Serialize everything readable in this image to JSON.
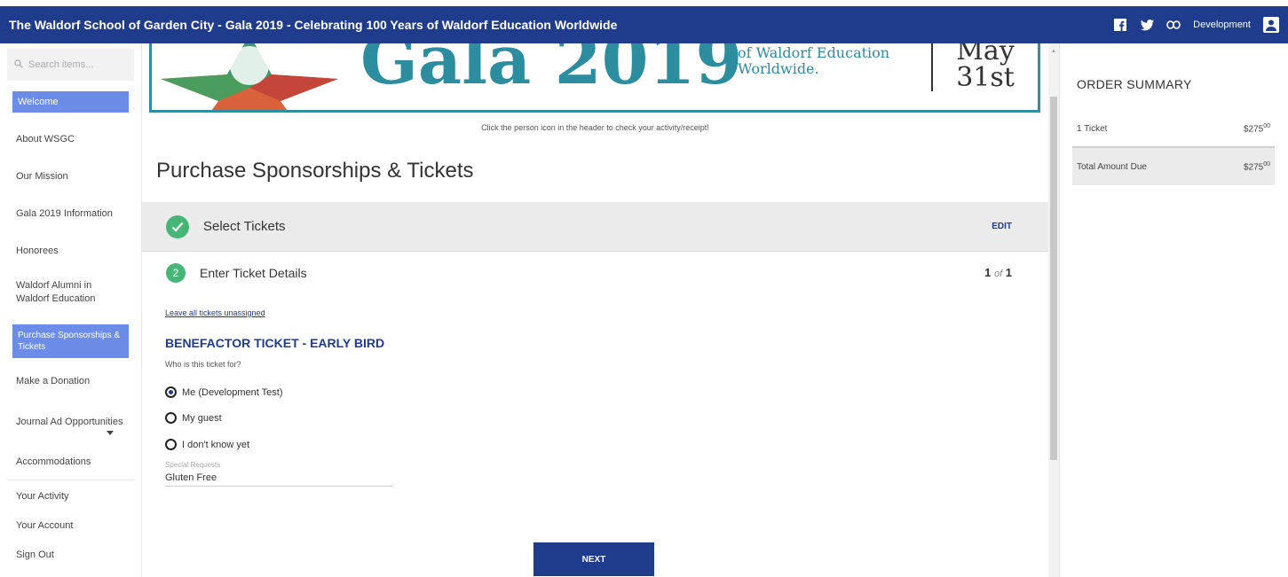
{
  "header": {
    "title": "The Waldorf School of Garden City - Gala 2019 - Celebrating 100 Years of Waldorf Education Worldwide",
    "user": "Development",
    "icons": [
      "facebook-icon",
      "twitter-icon",
      "link-icon",
      "user-icon"
    ]
  },
  "sidebar": {
    "search_placeholder": "Search items...",
    "items": [
      {
        "label": "Welcome",
        "active": true
      },
      {
        "label": "About WSGC"
      },
      {
        "label": "Our Mission"
      },
      {
        "label": "Gala 2019 Information"
      },
      {
        "label": "Honorees"
      },
      {
        "label": "Waldorf Alumni in Waldorf Education"
      },
      {
        "label": "Purchase Sponsorships & Tickets",
        "active": true
      },
      {
        "label": "Make a Donation"
      },
      {
        "label": "Journal Ad Opportunities"
      },
      {
        "label": "Accommodations"
      },
      {
        "label": "Your Activity"
      },
      {
        "label": "Your Account"
      },
      {
        "label": "Sign Out"
      }
    ]
  },
  "banner": {
    "gala": "Gala 2019",
    "subtitle_line1": "of Waldorf Education",
    "subtitle_line2": "Worldwide.",
    "date_line1": "May",
    "date_line2": "31st"
  },
  "main": {
    "notice": "Click the person icon in the header to check your activity/receipt!",
    "page_title": "Purchase Sponsorships & Tickets",
    "step1": {
      "label": "Select Tickets",
      "edit": "EDIT"
    },
    "step2": {
      "number": "2",
      "label": "Enter Ticket Details",
      "current": "1",
      "of": "of",
      "total": "1"
    },
    "unassign_link": "Leave all tickets unassigned",
    "ticket_name": "BENEFACTOR TICKET - EARLY BIRD",
    "who_question": "Who is this ticket for?",
    "options": [
      {
        "label": "Me (Development Test)",
        "checked": true
      },
      {
        "label": "My guest",
        "checked": false
      },
      {
        "label": "I don't know yet",
        "checked": false
      }
    ],
    "special_requests_label": "Special Requests",
    "special_requests_value": "Gluten Free",
    "next_button": "NEXT"
  },
  "summary": {
    "heading": "ORDER SUMMARY",
    "line_item": {
      "label": "1 Ticket",
      "amount": "$275",
      "cents": "00"
    },
    "total": {
      "label": "Total Amount Due",
      "amount": "$275",
      "cents": "00"
    }
  },
  "colors": {
    "header_bg": "#1f3c8c",
    "accent_green": "#46b677",
    "active_nav": "#6b8de8",
    "banner_teal": "#2b8d9e"
  }
}
